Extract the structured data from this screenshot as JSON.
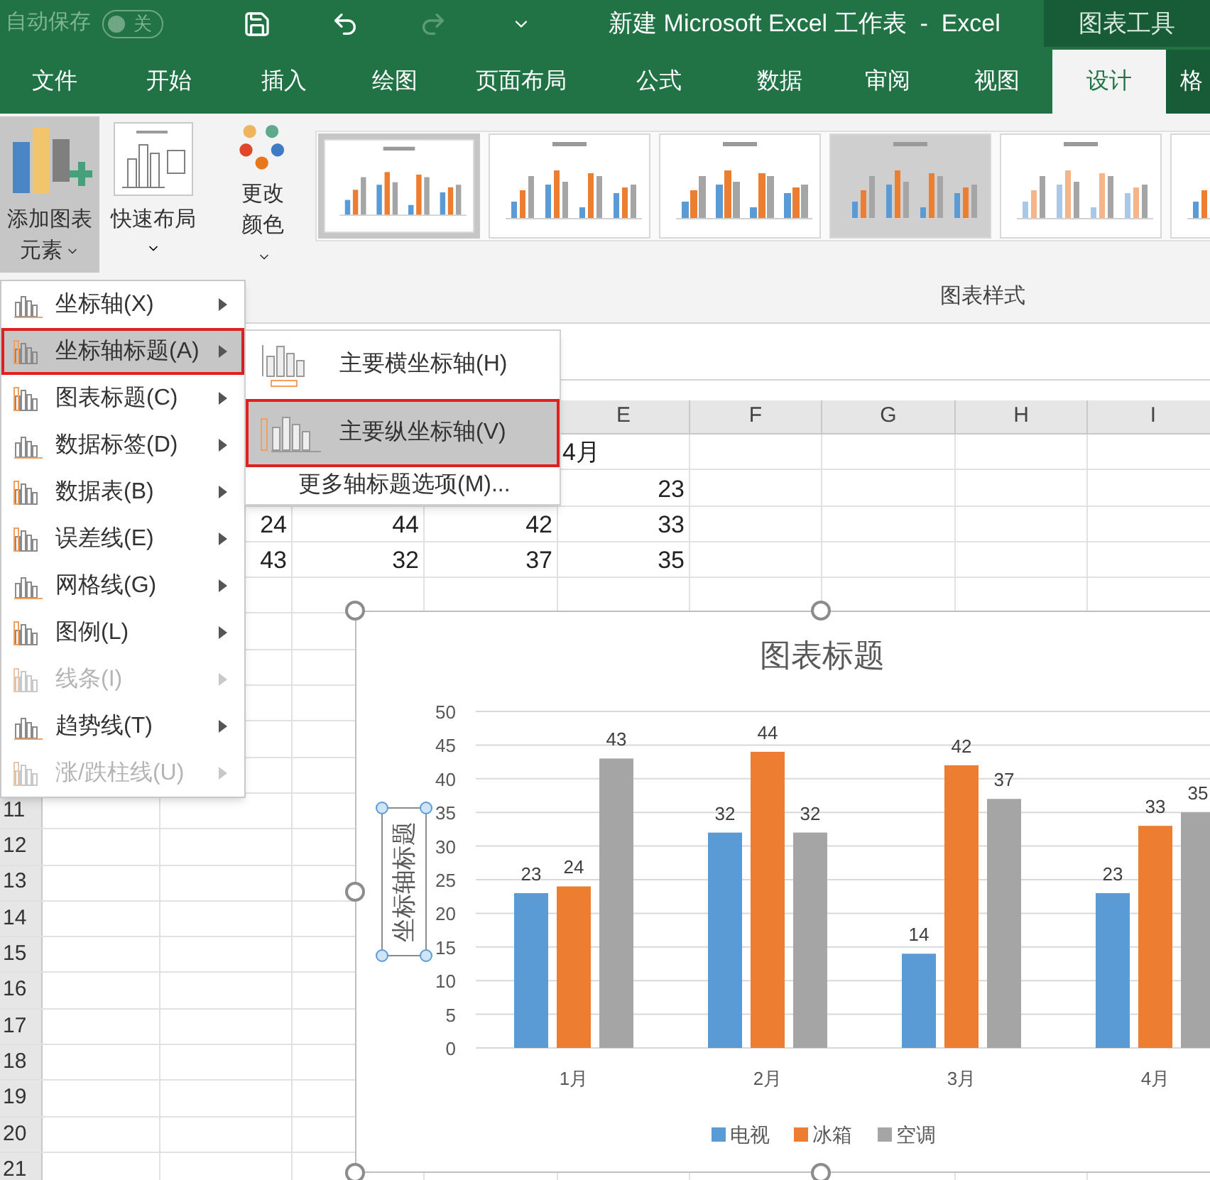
{
  "title_bar": {
    "autosave_label": "自动保存",
    "autosave_toggle": {
      "on": false,
      "label": "关"
    },
    "title": "新建 Microsoft Excel 工作表  -  Excel",
    "context_label": "图表工具"
  },
  "tabs": [
    {
      "label": "文件",
      "selected": false
    },
    {
      "label": "开始",
      "selected": false
    },
    {
      "label": "插入",
      "selected": false
    },
    {
      "label": "绘图",
      "selected": false
    },
    {
      "label": "页面布局",
      "selected": false
    },
    {
      "label": "公式",
      "selected": false
    },
    {
      "label": "数据",
      "selected": false
    },
    {
      "label": "审阅",
      "selected": false
    },
    {
      "label": "视图",
      "selected": false
    },
    {
      "label": "设计",
      "selected": true
    },
    {
      "label": "格",
      "selected": false
    }
  ],
  "ribbon": {
    "buttons": [
      {
        "kind": "add_element",
        "label": "添加图表元素",
        "pressed": true
      },
      {
        "kind": "quick_layout",
        "label": "快速布局",
        "pressed": false
      },
      {
        "kind": "change_colors",
        "label": "更改颜色",
        "pressed": false
      }
    ],
    "chart_styles": [
      {
        "selected": true
      },
      {
        "selected": false
      },
      {
        "selected": false
      },
      {
        "selected": false
      },
      {
        "selected": false
      },
      {
        "selected": false
      }
    ],
    "group_label": "图表样式"
  },
  "sheet": {
    "columns": [
      {},
      {},
      {},
      {},
      {
        "header": "E"
      },
      {
        "header": "F"
      },
      {
        "header": "G"
      },
      {
        "header": "H"
      },
      {
        "header": "I"
      }
    ],
    "rows": [
      {
        "cells": [
          {},
          {},
          {},
          {},
          {
            "text": "4月",
            "kind": "text"
          }
        ]
      },
      {
        "cells": [
          {},
          {},
          {},
          {},
          {
            "text": "23",
            "kind": "number"
          }
        ]
      },
      {
        "cells": [
          {},
          {
            "text": "24",
            "kind": "number"
          },
          {
            "text": "44",
            "kind": "number"
          },
          {
            "text": "42",
            "kind": "number"
          },
          {
            "text": "33",
            "kind": "number"
          }
        ]
      },
      {
        "cells": [
          {},
          {
            "text": "43",
            "kind": "number"
          },
          {
            "text": "32",
            "kind": "number"
          },
          {
            "text": "37",
            "kind": "number"
          },
          {
            "text": "35",
            "kind": "number"
          }
        ]
      },
      {},
      {},
      {},
      {},
      {},
      {},
      {
        "header": "11"
      },
      {
        "header": "12"
      },
      {
        "header": "13"
      },
      {
        "header": "14"
      },
      {
        "header": "15"
      },
      {
        "header": "16"
      },
      {
        "header": "17"
      },
      {
        "header": "18"
      },
      {
        "header": "19"
      },
      {
        "header": "20"
      },
      {
        "header": "21"
      }
    ]
  },
  "menu": {
    "items": [
      {
        "label": "坐标轴(X)",
        "selected": false,
        "disabled": false
      },
      {
        "label": "坐标轴标题(A)",
        "selected": true,
        "disabled": false
      },
      {
        "label": "图表标题(C)",
        "selected": false,
        "disabled": false
      },
      {
        "label": "数据标签(D)",
        "selected": false,
        "disabled": false
      },
      {
        "label": "数据表(B)",
        "selected": false,
        "disabled": false
      },
      {
        "label": "误差线(E)",
        "selected": false,
        "disabled": false
      },
      {
        "label": "网格线(G)",
        "selected": false,
        "disabled": false
      },
      {
        "label": "图例(L)",
        "selected": false,
        "disabled": false
      },
      {
        "label": "线条(I)",
        "selected": false,
        "disabled": true
      },
      {
        "label": "趋势线(T)",
        "selected": false,
        "disabled": false
      },
      {
        "label": "涨/跌柱线(U)",
        "selected": false,
        "disabled": true
      }
    ]
  },
  "submenu": {
    "items": [
      {
        "kind": "horizontal",
        "label": "主要横坐标轴(H)",
        "selected": false
      },
      {
        "kind": "vertical",
        "label": "主要纵坐标轴(V)",
        "selected": true
      },
      {
        "kind": "more",
        "label": "更多轴标题选项(M)...",
        "selected": false
      }
    ]
  },
  "chart": {
    "axis_title_selected": true,
    "chart_data": {
      "type": "bar",
      "title": "图表标题",
      "ylabel": "坐标轴标题",
      "categories": [
        "1月",
        "2月",
        "3月",
        "4月"
      ],
      "series": [
        {
          "name": "电视",
          "color": "#5b9bd5",
          "values": [
            23,
            32,
            14,
            23
          ]
        },
        {
          "name": "冰箱",
          "color": "#ed7d31",
          "values": [
            24,
            44,
            42,
            33
          ]
        },
        {
          "name": "空调",
          "color": "#a5a5a5",
          "values": [
            43,
            32,
            37,
            35
          ]
        }
      ],
      "ylim": [
        0,
        50
      ],
      "yticks": [
        0,
        5,
        10,
        15,
        20,
        25,
        30,
        35,
        40,
        45,
        50
      ],
      "data_labels": true,
      "grid": true,
      "legend": true
    }
  }
}
